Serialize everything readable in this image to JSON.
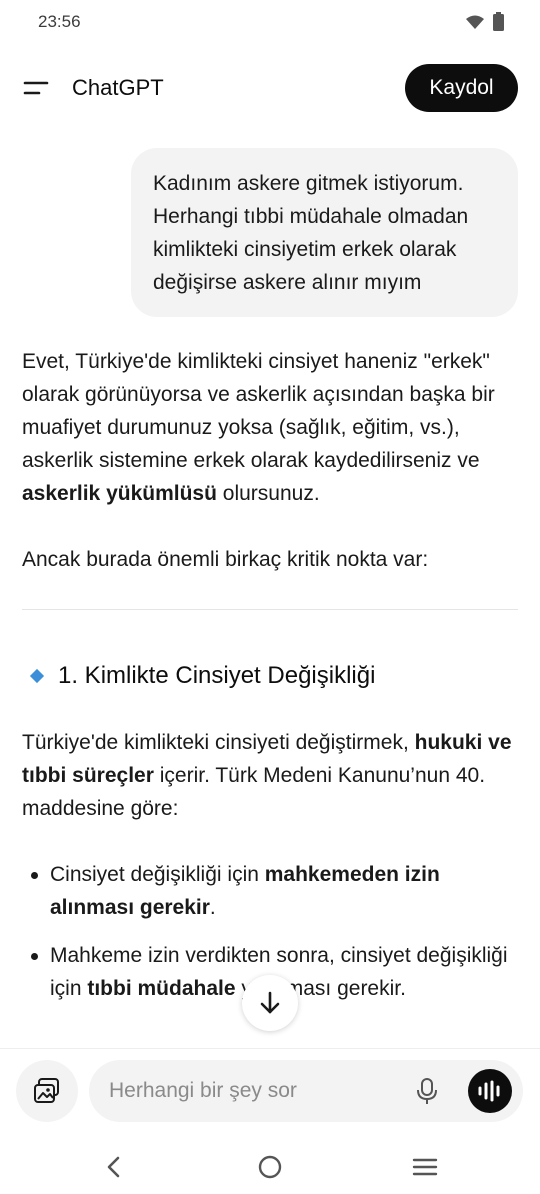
{
  "status_bar": {
    "time": "23:56"
  },
  "header": {
    "title": "ChatGPT",
    "signup_label": "Kaydol"
  },
  "conversation": {
    "user_message": "Kadınım askere gitmek istiyorum. Herhangi tıbbi müdahale olmadan kimlikteki cinsiyetim erkek olarak değişirse askere alınır mıyım",
    "reply": {
      "p1_text": "Evet, Türkiye'de kimlikteki cinsiyet haneniz \"erkek\" olarak görünüyorsa ve askerlik açısından başka bir muafiyet durumunuz yoksa (sağlık, eğitim, vs.), askerlik sistemine erkek olarak kaydedilirseniz ve ",
      "p1_bold": "askerlik yükümlüsü",
      "p1_end": " olursunuz.",
      "p2": "Ancak burada önemli birkaç kritik nokta var:",
      "section1_title": "1. Kimlikte Cinsiyet Değişikliği",
      "p3_text": "Türkiye'de kimlikteki cinsiyeti değiştirmek, ",
      "p3_bold": "hukuki ve tıbbi süreçler",
      "p3_end": " içerir. Türk Medeni Kanunu’nun 40. maddesine göre:",
      "bullet1_text": "Cinsiyet değişikliği için ",
      "bullet1_bold": "mahkemeden izin alınması gerekir",
      "bullet1_end": ".",
      "bullet2_text": "Mahkeme izin verdikten sonra, cinsiyet değişikliği için ",
      "bullet2_bold": "tıbbi müdahale",
      "bullet2_end": " yapılması gerekir."
    }
  },
  "composer": {
    "placeholder": "Herhangi bir şey sor"
  },
  "colors": {
    "accent_dark": "#0d0d0d",
    "bubble_bg": "#f3f3f3",
    "diamond": "#3b8fd9"
  },
  "icons": {
    "menu": "menu-icon",
    "scroll": "arrow-down-icon",
    "attach": "image-gallery-icon",
    "mic": "microphone-icon",
    "voice": "voice-waveform-icon",
    "back": "back-icon",
    "home": "home-icon",
    "recents": "recents-icon"
  }
}
